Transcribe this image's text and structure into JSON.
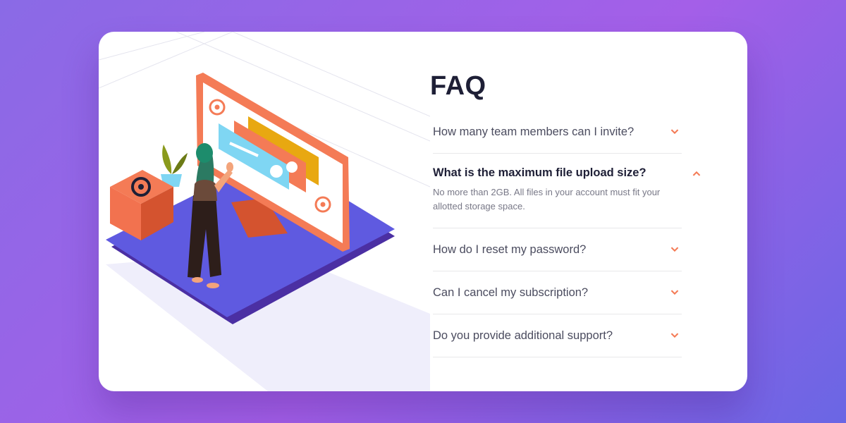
{
  "faq": {
    "title": "FAQ",
    "items": [
      {
        "question": "How many team members can I invite?",
        "open": false
      },
      {
        "question": "What is the maximum file upload size?",
        "open": true,
        "answer": "No more than 2GB. All files in your account must fit your allotted storage space."
      },
      {
        "question": "How do I reset my password?",
        "open": false
      },
      {
        "question": "Can I cancel my subscription?",
        "open": false
      },
      {
        "question": "Do you provide additional support?",
        "open": false
      }
    ],
    "chevron_icon": "chevron-down-icon"
  },
  "colors": {
    "accent": "#f47b56",
    "heading": "#1e1f36",
    "text": "#4b4c5f",
    "muted": "#787887",
    "divider": "#e8e8ea"
  }
}
